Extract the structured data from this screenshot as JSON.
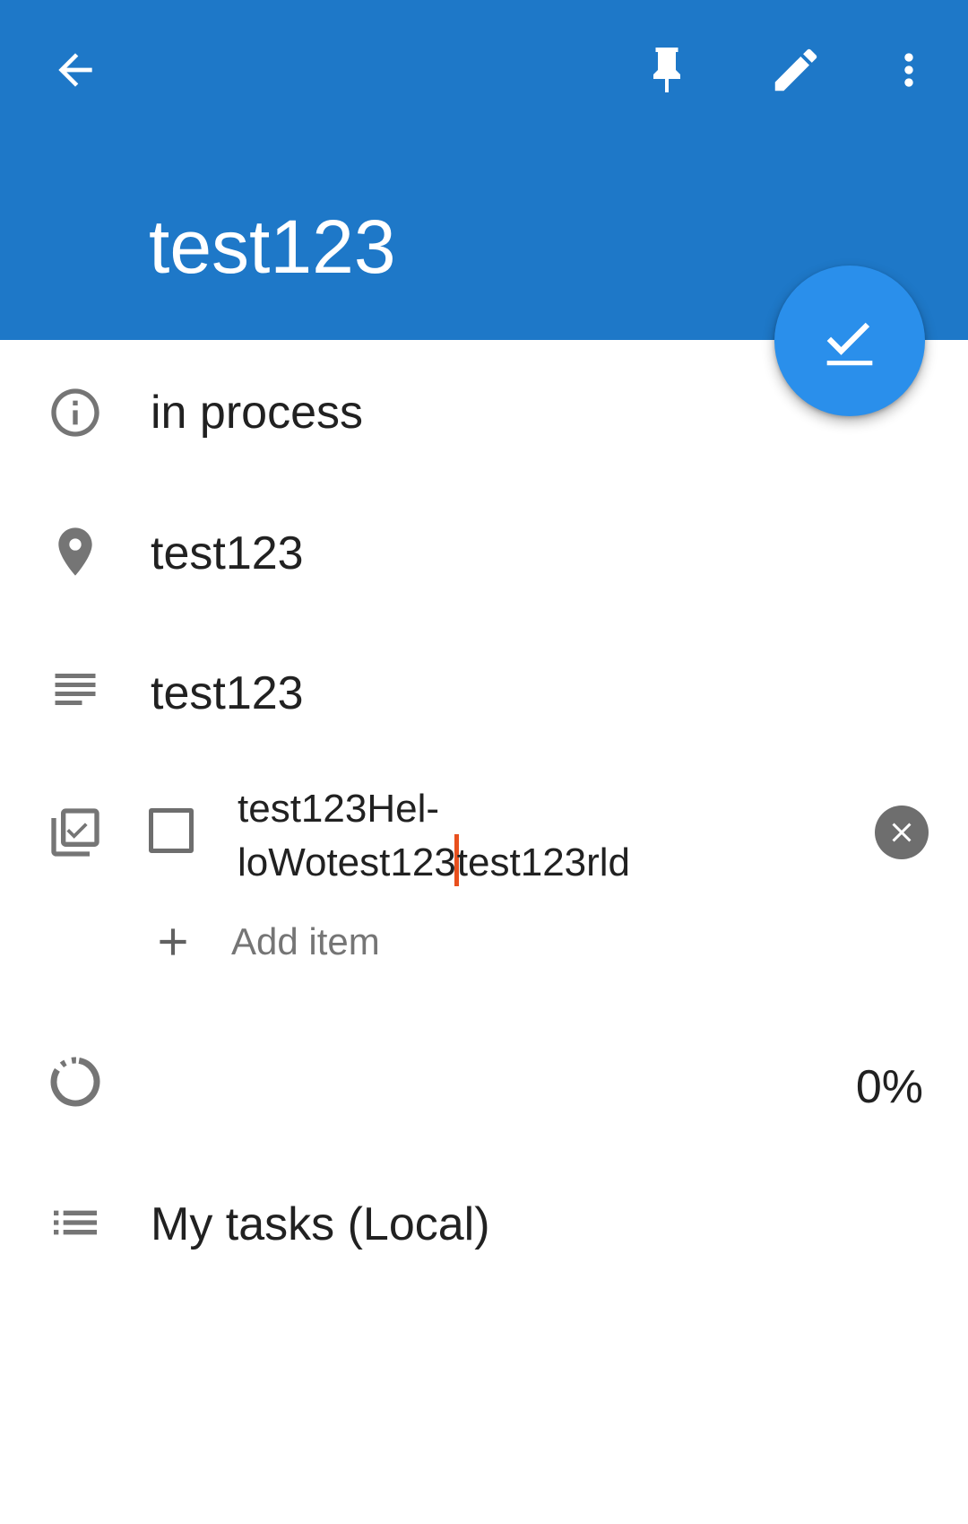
{
  "colors": {
    "appbar": "#1E78C8",
    "fab": "#2A8FEB",
    "icon_gray": "#757575",
    "text_primary": "#212121",
    "cursor": "#E8501E"
  },
  "toolbar": {
    "back_icon": "arrow-back-icon",
    "pin_icon": "pin-icon",
    "edit_icon": "pencil-icon",
    "more_icon": "more-vert-icon"
  },
  "task": {
    "title": "test123",
    "status": "in process",
    "location": "test123",
    "description": "test123",
    "checklist": {
      "item_line1": "test123Hel-",
      "item_line2_before_cursor": "loWotest123",
      "item_line2_after_cursor": "test123rld",
      "checked": false,
      "add_item_label": "Add item"
    },
    "progress": "0%",
    "list": "My tasks (Local)"
  }
}
